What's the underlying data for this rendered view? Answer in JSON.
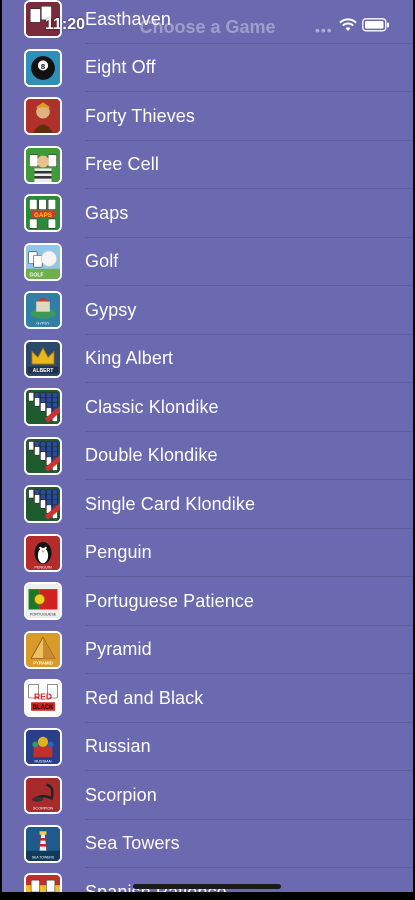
{
  "status_bar": {
    "time": "11:20"
  },
  "nav": {
    "title": "Choose a Game"
  },
  "games": [
    {
      "label": "Easthaven",
      "icon": "easthaven-icon",
      "color": "#7a2a3a"
    },
    {
      "label": "Eight Off",
      "icon": "eight-ball-icon",
      "color": "#2f8fb8"
    },
    {
      "label": "Forty Thieves",
      "icon": "thief-icon",
      "color": "#b0302a"
    },
    {
      "label": "Free Cell",
      "icon": "prisoner-icon",
      "color": "#3f9a3a"
    },
    {
      "label": "Gaps",
      "icon": "gaps-icon",
      "color": "#2c8a3a"
    },
    {
      "label": "Golf",
      "icon": "golf-ball-icon",
      "color": "#6fb04a"
    },
    {
      "label": "Gypsy",
      "icon": "caravan-icon",
      "color": "#2f7fa8"
    },
    {
      "label": "King Albert",
      "icon": "crown-icon",
      "color": "#2b4a6a"
    },
    {
      "label": "Classic Klondike",
      "icon": "klondike-icon",
      "color": "#1f5a2e"
    },
    {
      "label": "Double Klondike",
      "icon": "klondike-icon",
      "color": "#1f5a2e"
    },
    {
      "label": "Single Card Klondike",
      "icon": "klondike-icon",
      "color": "#1f5a2e"
    },
    {
      "label": "Penguin",
      "icon": "penguin-icon",
      "color": "#b52a2a"
    },
    {
      "label": "Portuguese Patience",
      "icon": "portugal-flag-icon",
      "color": "#2a8a3a"
    },
    {
      "label": "Pyramid",
      "icon": "pyramid-icon",
      "color": "#d89a2a"
    },
    {
      "label": "Red and Black",
      "icon": "red-black-icon",
      "color": "#2a2a2a"
    },
    {
      "label": "Russian",
      "icon": "cathedral-icon",
      "color": "#2a3f8a"
    },
    {
      "label": "Scorpion",
      "icon": "scorpion-icon",
      "color": "#a82a2a"
    },
    {
      "label": "Sea Towers",
      "icon": "lighthouse-icon",
      "color": "#1f5a8a"
    },
    {
      "label": "Spanish Patience",
      "icon": "spain-icon",
      "color": "#c0302a"
    }
  ]
}
